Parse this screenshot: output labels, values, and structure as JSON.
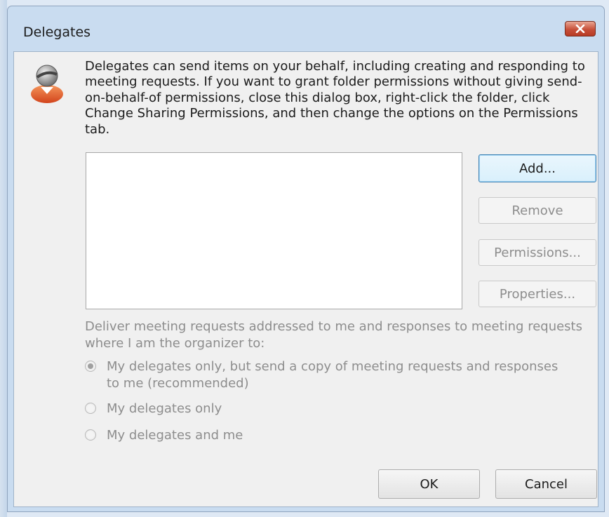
{
  "window": {
    "title": "Delegates"
  },
  "icons": {
    "user": "user-icon",
    "close": "close-icon"
  },
  "intro_text": "Delegates can send items on your behalf, including creating and responding to meeting requests. If you want to grant folder permissions without giving send-on-behalf-of permissions, close this dialog box, right-click the folder, click Change Sharing Permissions, and then change the options on the Permissions tab.",
  "delegates_list": [],
  "buttons": {
    "add": "Add...",
    "remove": "Remove",
    "permissions": "Permissions...",
    "properties": "Properties...",
    "ok": "OK",
    "cancel": "Cancel"
  },
  "deliver": {
    "label": "Deliver meeting requests addressed to me and responses to meeting requests where I am the organizer to:",
    "options": [
      {
        "label": "My delegates only, but send a copy of meeting requests and responses to me (recommended)",
        "selected": true,
        "enabled": false
      },
      {
        "label": "My delegates only",
        "selected": false,
        "enabled": false
      },
      {
        "label": "My delegates and me",
        "selected": false,
        "enabled": false
      }
    ]
  },
  "colors": {
    "close_button": "#c7503a",
    "default_button_border": "#3c7fb1",
    "disabled_text": "#8d8d8d",
    "frame": "#c9dcf0"
  }
}
